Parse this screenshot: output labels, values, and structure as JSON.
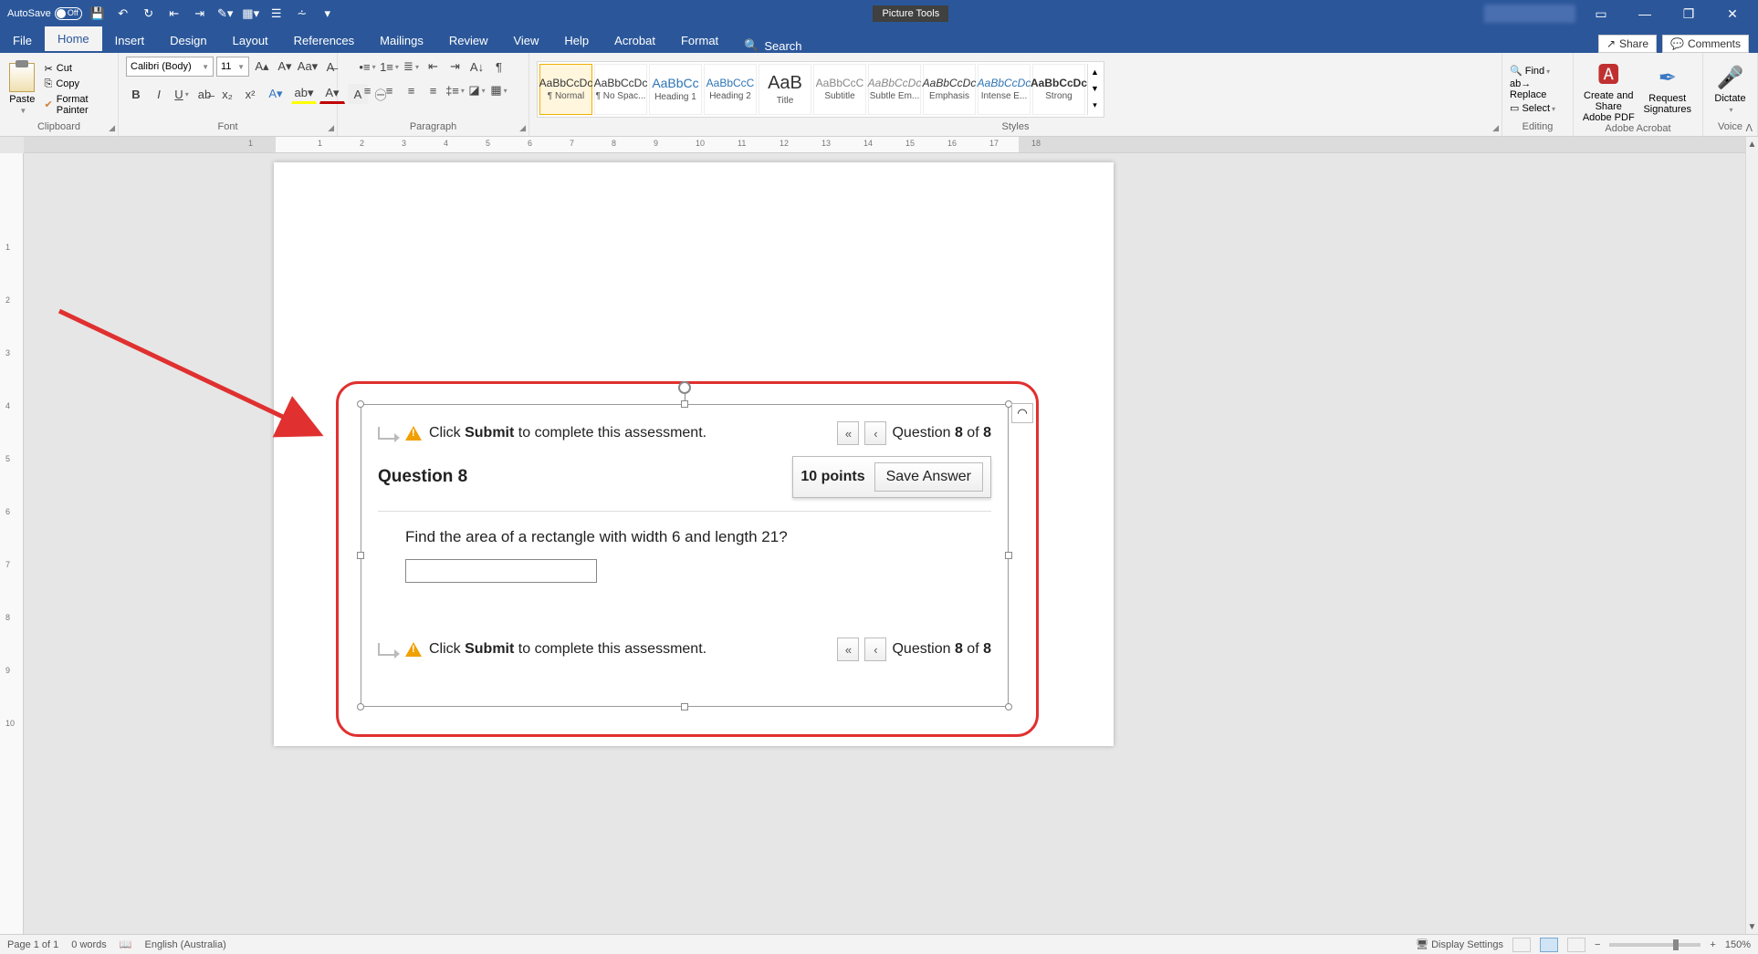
{
  "titlebar": {
    "autosave_label": "AutoSave",
    "autosave_state": "Off",
    "picture_tools": "Picture Tools",
    "min": "—",
    "restore": "❐",
    "close": "✕",
    "ribbon_opts": "⏷"
  },
  "tabs": {
    "file": "File",
    "home": "Home",
    "insert": "Insert",
    "design": "Design",
    "layout": "Layout",
    "references": "References",
    "mailings": "Mailings",
    "review": "Review",
    "view": "View",
    "help": "Help",
    "acrobat": "Acrobat",
    "format": "Format",
    "search": "Search",
    "share": "Share",
    "comments": "Comments"
  },
  "ribbon": {
    "clipboard": {
      "label": "Clipboard",
      "paste": "Paste",
      "cut": "Cut",
      "copy": "Copy",
      "fmt": "Format Painter"
    },
    "font": {
      "label": "Font",
      "name": "Calibri (Body)",
      "size": "11"
    },
    "paragraph": {
      "label": "Paragraph"
    },
    "styles": {
      "label": "Styles",
      "items": [
        {
          "preview": "AaBbCcDc",
          "name": "¶ Normal"
        },
        {
          "preview": "AaBbCcDc",
          "name": "¶ No Spac..."
        },
        {
          "preview": "AaBbCc",
          "name": "Heading 1"
        },
        {
          "preview": "AaBbCcC",
          "name": "Heading 2"
        },
        {
          "preview": "AaB",
          "name": "Title"
        },
        {
          "preview": "AaBbCcC",
          "name": "Subtitle"
        },
        {
          "preview": "AaBbCcDc",
          "name": "Subtle Em..."
        },
        {
          "preview": "AaBbCcDc",
          "name": "Emphasis"
        },
        {
          "preview": "AaBbCcDc",
          "name": "Intense E..."
        },
        {
          "preview": "AaBbCcDc",
          "name": "Strong"
        }
      ]
    },
    "editing": {
      "label": "Editing",
      "find": "Find",
      "replace": "Replace",
      "select": "Select"
    },
    "acrobat": {
      "label": "Adobe Acrobat",
      "create": "Create and Share Adobe PDF",
      "request": "Request Signatures"
    },
    "voice": {
      "label": "Voice",
      "dictate": "Dictate"
    }
  },
  "assessment": {
    "submit_prefix": "Click ",
    "submit_bold": "Submit",
    "submit_suffix": " to complete this assessment.",
    "question_word": "Question ",
    "q_current": "8",
    "q_of": " of ",
    "q_total": "8",
    "q_title": "Question 8",
    "points": "10 points",
    "save": "Save Answer",
    "text": "Find the area of a rectangle with width 6 and length 21?"
  },
  "status": {
    "page": "Page 1 of 1",
    "words": "0 words",
    "lang": "English (Australia)",
    "display": "Display Settings",
    "zoom": "150%"
  },
  "ruler_ticks": [
    "1",
    "1",
    "2",
    "3",
    "4",
    "5",
    "6",
    "7",
    "8",
    "9",
    "10",
    "11",
    "12",
    "13",
    "14",
    "15",
    "16",
    "17",
    "18"
  ]
}
